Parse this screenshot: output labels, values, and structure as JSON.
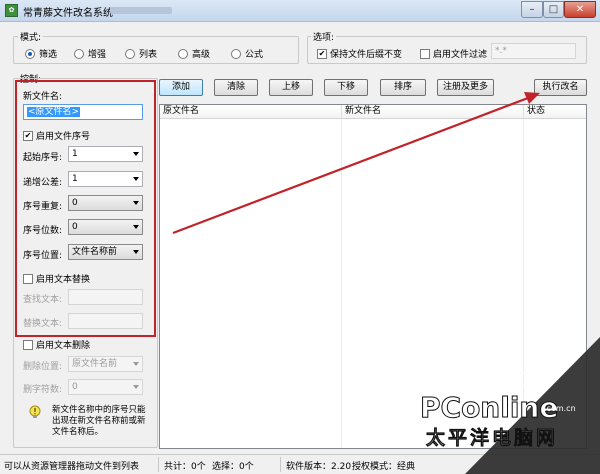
{
  "window": {
    "title": "常青藤文件改名系统",
    "minimize": "–",
    "maximize": "□",
    "close": "✕"
  },
  "mode": {
    "label": "模式:",
    "options": [
      "筛选",
      "增强",
      "列表",
      "高级",
      "公式"
    ],
    "selected": "筛选"
  },
  "options": {
    "label": "选项:",
    "keep_ext_label": "保持文件后缀不变",
    "keep_ext_checked": true,
    "filter_label": "启用文件过滤",
    "filter_checked": false,
    "filter_value": "*.*"
  },
  "control": {
    "label": "控制:",
    "new_name_label": "新文件名:",
    "new_name_value": "<原文件名>",
    "enable_seq_label": "启用文件序号",
    "enable_seq_checked": true,
    "start_label": "起始序号:",
    "start_value": "1",
    "step_label": "递增公差:",
    "step_value": "1",
    "repeat_label": "序号重复:",
    "repeat_value": "0",
    "digits_label": "序号位数:",
    "digits_value": "0",
    "position_label": "序号位置:",
    "position_value": "文件名称前",
    "enable_replace_label": "启用文本替换",
    "enable_replace_checked": false,
    "find_label": "查找文本:",
    "replace_label": "替换文本:",
    "enable_delete_label": "启用文本删除",
    "enable_delete_checked": false,
    "delete_pos_label": "删除位置:",
    "delete_pos_value": "原文件名前",
    "delete_count_label": "删字符数:",
    "delete_count_value": "0",
    "hint": "新文件名称中的序号只能出现在新文件名称前或新文件名称后。"
  },
  "toolbar": {
    "add": "添加",
    "clear": "清除",
    "up": "上移",
    "down": "下移",
    "sort": "排序",
    "register": "注册及更多",
    "execute": "执行改名"
  },
  "grid": {
    "columns": [
      "原文件名",
      "新文件名",
      "状态"
    ]
  },
  "status": {
    "drag_hint": "可以从资源管理器拖动文件到列表",
    "total": "共计：0个",
    "selected": "选择：0个",
    "version": "软件版本：2.20",
    "license": "授权模式：经典"
  },
  "watermark": {
    "brand": "PConline",
    "domain": ".com.cn",
    "cn": "太平洋电脑网"
  },
  "colors": {
    "annotation_red": "#c0242a"
  }
}
